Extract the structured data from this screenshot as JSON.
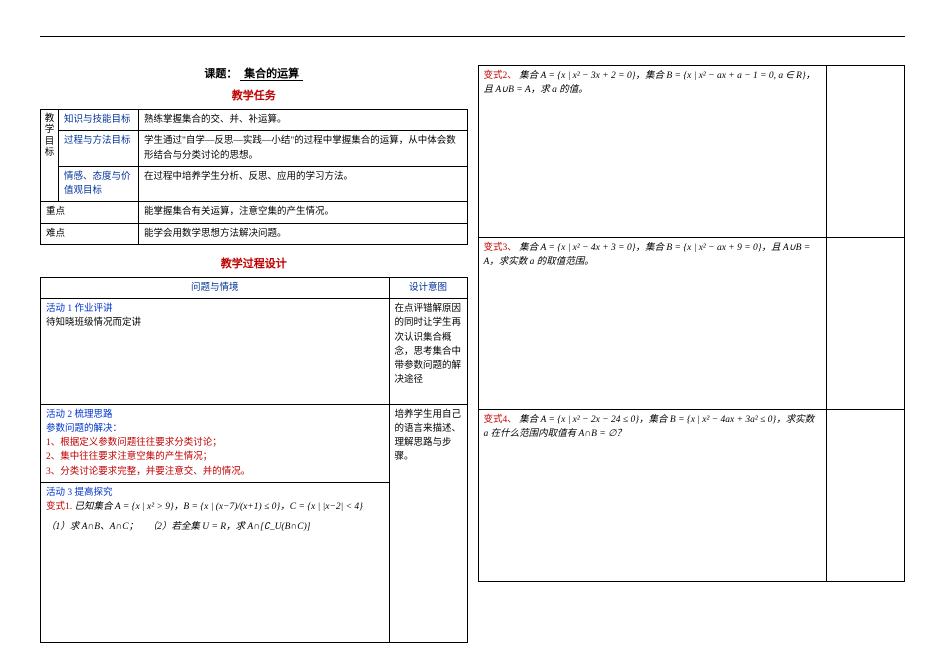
{
  "title_prefix": "课题：",
  "title_main": "集合的运算",
  "task_heading": "教学任务",
  "rows": {
    "goal_label": "教学目标",
    "r1_label": "知识与技能目标",
    "r1_text": "熟练掌握集合的交、并、补运算。",
    "r2_label": "过程与方法目标",
    "r2_text": "学生通过\"自学—反思—实践—小结\"的过程中掌握集合的运算，从中体会数形结合与分类讨论的思想。",
    "r3_label": "情感、态度与价值观目标",
    "r3_text": "在过程中培养学生分析、反思、应用的学习方法。",
    "key_label": "重点",
    "key_text": "能掌握集合有关运算，注意空集的产生情况。",
    "diff_label": "难点",
    "diff_text": "能学会用数学思想方法解决问题。"
  },
  "proc_heading": "教学过程设计",
  "proc": {
    "col1": "问题与情境",
    "col2": "设计意图",
    "a1_title": "活动 1 作业评讲",
    "a1_text": "待知晓班级情况而定讲",
    "a1_intent": "在点评错解原因的同时让学生再次认识集合概念，思考集合中带参数问题的解决途径",
    "a2_title": "活动 2 梳理思路",
    "a2_sub": "参数问题的解决：",
    "a2_l1": "1、根据定义参数问题往往要求分类讨论；",
    "a2_l2": "2、集中往往要求注意空集的产生情况；",
    "a2_l3": "3、分类讨论要求完整，并要注意交、并的情况。",
    "a2_intent": "培养学生用自己的语言来描述、理解思路与步骤。",
    "a3_title": "活动 3 提高探究",
    "v1_label": "变式1.",
    "v1_text": "已知集合 A = {x | x² > 9}，B = {x | (x−7)/(x+1) ≤ 0}，C = {x | |x−2| < 4}",
    "v1_q1": "（1）求 A∩B、A∩C；",
    "v1_q2": "（2）若全集 U = R，求 A∩[∁_U(B∩C)]"
  },
  "right": {
    "v2_label": "变式2、",
    "v2_text": "集合 A = {x | x² − 3x + 2 = 0}，集合 B = {x | x² − ax + a − 1 = 0, a ∈ R}，且 A∪B = A，求 a 的值。",
    "v3_label": "变式3、",
    "v3_text": "集合 A = {x | x² − 4x + 3 = 0}，集合 B = {x | x² − ax + 9 = 0}，且 A∪B = A，求实数 a 的取值范围。",
    "v4_label": "变式4、",
    "v4_text": "集合 A = {x | x² − 2x − 24 ≤ 0}，集合 B = {x | x² − 4ax + 3a² ≤ 0}，求实数 a 在什么范围内取值有 A∩B = ∅？"
  }
}
